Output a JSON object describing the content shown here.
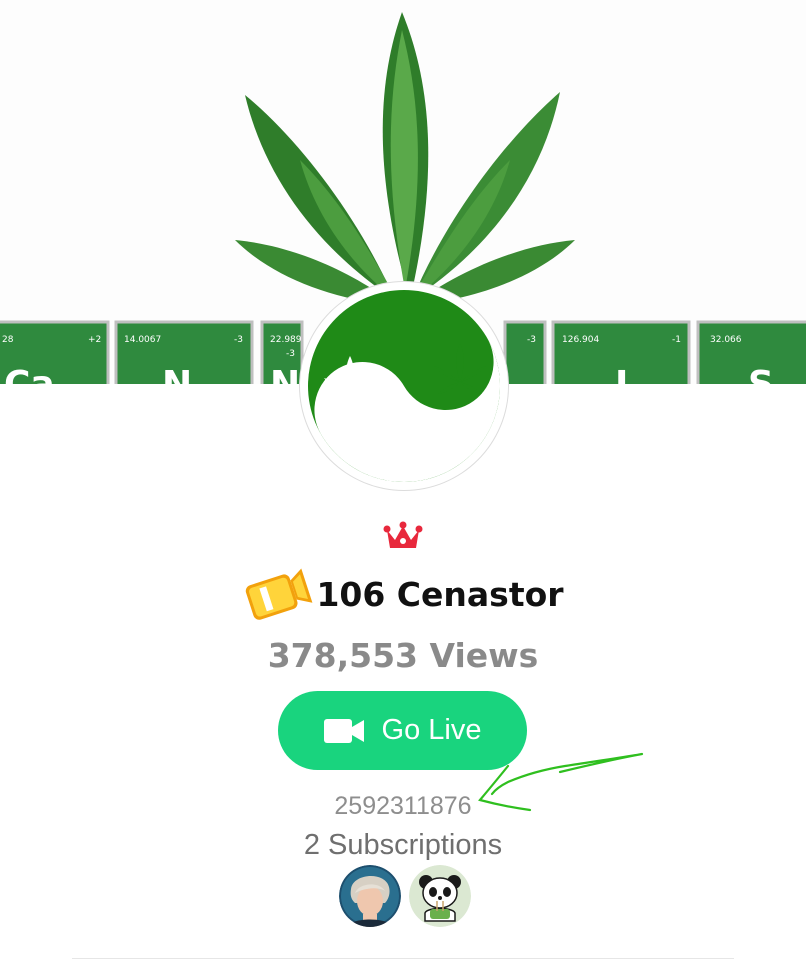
{
  "banner": {
    "tiles": [
      {
        "number": "28",
        "charge": "+2",
        "symbol": "Ca",
        "color": "#2f8a3e"
      },
      {
        "number": "14.0067",
        "charge": "-3",
        "symbol": "N",
        "color": "#2f8a3e"
      },
      {
        "number": "22.989",
        "charge": "-3",
        "symbol": "Na",
        "color": "#2f8a3e"
      },
      {
        "number": "",
        "charge": "-3",
        "symbol": "",
        "color": "#2f8a3e"
      },
      {
        "number": "126.904",
        "charge": "-1",
        "symbol": "I",
        "color": "#2f8a3e"
      },
      {
        "number": "32.066",
        "charge": "",
        "symbol": "S",
        "color": "#2f8a3e"
      }
    ]
  },
  "avatar": {
    "icon": "yin-yang-leaf-icon",
    "green": "#1f8a17"
  },
  "badge": {
    "crown_icon": "crown-icon",
    "crown_color": "#e8283c",
    "rank_icon": "video-rank-badge-icon"
  },
  "channel": {
    "name": "106 Cenastor"
  },
  "stats": {
    "views": "378,553 Views"
  },
  "go_live": {
    "label": "Go Live",
    "icon": "video-camera-icon",
    "color": "#19d47e"
  },
  "user_id": "2592311876",
  "subscriptions": {
    "label": "2 Subscriptions",
    "avatars": [
      {
        "name": "subscriber-avatar-1"
      },
      {
        "name": "subscriber-avatar-2"
      }
    ]
  }
}
